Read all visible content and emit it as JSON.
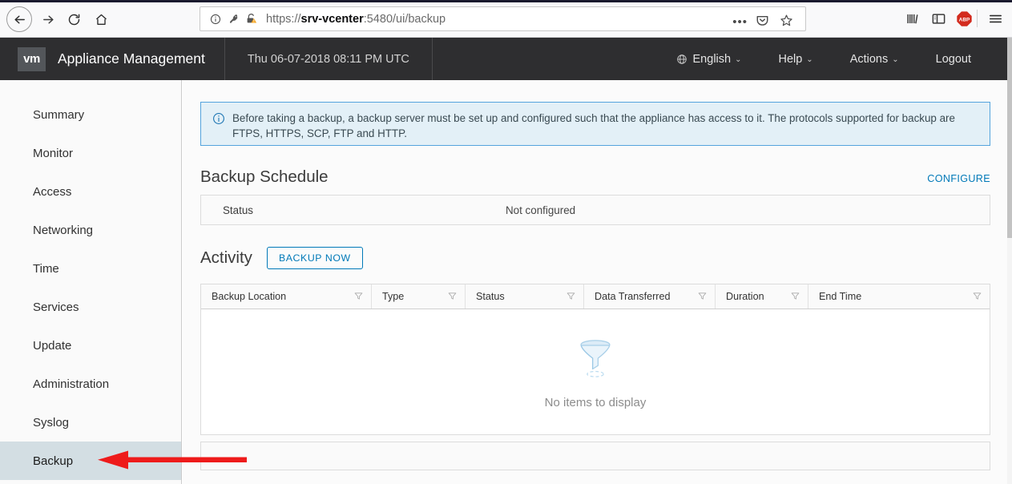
{
  "browser": {
    "back_icon": "back-arrow-icon",
    "forward_icon": "forward-arrow-icon",
    "reload_icon": "reload-icon",
    "home_icon": "home-icon",
    "url_prefix": "https://",
    "url_host": "srv-vcenter",
    "url_suffix": ":5480/ui/backup",
    "url_full": "https://srv-vcenter:5480/ui/backup",
    "page_actions_label": "•••",
    "icons": {
      "info": "page-info-icon",
      "key": "key-icon",
      "lock_warning": "insecure-lock-warning-icon",
      "pocket": "pocket-icon",
      "star": "bookmark-star-icon",
      "library": "library-icon",
      "sidebar": "sidebar-toggle-icon",
      "adblock": "adblock-plus-icon",
      "adblock_label": "ABP",
      "menu": "hamburger-menu-icon"
    }
  },
  "header": {
    "logo_text": "vm",
    "title": "Appliance Management",
    "datetime": "Thu 06-07-2018 08:11 PM UTC",
    "menus": [
      {
        "label": "English",
        "icon": "globe-icon",
        "caret": "⌄"
      },
      {
        "label": "Help",
        "caret": "⌄"
      },
      {
        "label": "Actions",
        "caret": "⌄"
      },
      {
        "label": "Logout",
        "caret": ""
      }
    ]
  },
  "sidebar": {
    "items": [
      {
        "label": "Summary",
        "active": false
      },
      {
        "label": "Monitor",
        "active": false
      },
      {
        "label": "Access",
        "active": false
      },
      {
        "label": "Networking",
        "active": false
      },
      {
        "label": "Time",
        "active": false
      },
      {
        "label": "Services",
        "active": false
      },
      {
        "label": "Update",
        "active": false
      },
      {
        "label": "Administration",
        "active": false
      },
      {
        "label": "Syslog",
        "active": false
      },
      {
        "label": "Backup",
        "active": true
      }
    ],
    "active_index": 9,
    "active_bg": "#d3dee3"
  },
  "main": {
    "info_banner": {
      "icon": "info-circle-icon",
      "text": "Before taking a backup, a backup server must be set up and configured such that the appliance has access to it. The protocols supported for backup are FTPS, HTTPS, SCP, FTP and HTTP.",
      "border_color": "#54a4dd",
      "bg_color": "#e3f0f7"
    },
    "backup_schedule": {
      "title": "Backup Schedule",
      "configure_label": "CONFIGURE",
      "status_label": "Status",
      "status_value": "Not configured"
    },
    "activity": {
      "title": "Activity",
      "backup_now_label": "BACKUP NOW",
      "accent_color": "#0079b8",
      "columns": [
        {
          "label": "Backup Location",
          "filter_icon": "filter-funnel-icon"
        },
        {
          "label": "Type",
          "filter_icon": "filter-funnel-icon"
        },
        {
          "label": "Status",
          "filter_icon": "filter-funnel-icon"
        },
        {
          "label": "Data Transferred",
          "filter_icon": "filter-funnel-icon"
        },
        {
          "label": "Duration",
          "filter_icon": "filter-funnel-icon"
        },
        {
          "label": "End Time",
          "filter_icon": "filter-funnel-icon"
        }
      ],
      "rows": [],
      "empty_icon": "empty-funnel-illustration",
      "empty_text": "No items to display"
    }
  },
  "annotation": {
    "arrow_color": "#ee1b1b",
    "arrow_direction": "left",
    "points_at": "Backup"
  }
}
